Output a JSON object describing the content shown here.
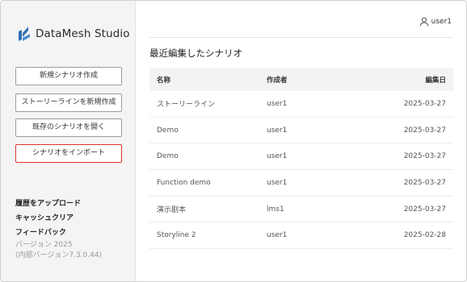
{
  "app": {
    "title": "DataMesh Studio"
  },
  "sidebar": {
    "buttons": [
      {
        "label": "新規シナリオ作成"
      },
      {
        "label": "ストーリーラインを新規作成"
      },
      {
        "label": "既存のシナリオを開く"
      },
      {
        "label": "シナリオをインポート"
      }
    ],
    "links": [
      {
        "label": "履歴をアップロード"
      },
      {
        "label": "キャッシュクリア"
      },
      {
        "label": "フィードバック"
      }
    ],
    "version": "バージョン 2025",
    "internal_version": "(内部バージョン7.3.0.44)"
  },
  "header": {
    "username": "user1"
  },
  "main": {
    "section_title": "最近編集したシナリオ",
    "columns": {
      "name": "名称",
      "author": "作成者",
      "date": "編集日"
    },
    "rows": [
      {
        "name": "ストーリーライン",
        "author": "user1",
        "date": "2025-03-27"
      },
      {
        "name": "Demo",
        "author": "user1",
        "date": "2025-03-27"
      },
      {
        "name": "Demo",
        "author": "user1",
        "date": "2025-03-27"
      },
      {
        "name": "Function demo",
        "author": "user1",
        "date": "2025-03-27"
      },
      {
        "name": "演示剧本",
        "author": "lms1",
        "date": "2025-03-27"
      },
      {
        "name": "Storyline 2",
        "author": "user1",
        "date": "2025-02-28"
      }
    ]
  },
  "colors": {
    "highlight_border": "#d9342b",
    "logo_blue": "#2f6fb3",
    "sidebar_bg": "#f4f4f4"
  }
}
